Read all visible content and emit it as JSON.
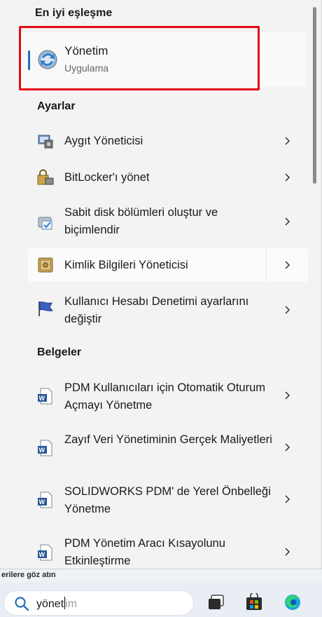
{
  "best_match": {
    "heading": "En iyi eşleşme",
    "name": "Yönetim",
    "type": "Uygulama"
  },
  "settings": {
    "heading": "Ayarlar",
    "items": [
      {
        "label": "Aygıt Yöneticisi",
        "icon": "device-manager-icon"
      },
      {
        "label": "BitLocker'ı yönet",
        "icon": "bitlocker-icon"
      },
      {
        "label": "Sabit disk bölümleri oluştur ve biçimlendir",
        "icon": "disk-partition-icon"
      },
      {
        "label": "Kimlik Bilgileri Yöneticisi",
        "icon": "credential-vault-icon"
      },
      {
        "label": "Kullanıcı Hesabı Denetimi ayarlarını değiştir",
        "icon": "uac-flag-icon"
      }
    ]
  },
  "documents": {
    "heading": "Belgeler",
    "items": [
      {
        "label": "PDM Kullanıcıları için Otomatik Oturum Açmayı Yönetme",
        "icon": "word-document-icon"
      },
      {
        "label": "Zayıf Veri Yönetiminin Gerçek Maliyetleri",
        "icon": "word-document-icon"
      },
      {
        "label": "SOLIDWORKS PDM' de Yerel Önbelleği Yönetme",
        "icon": "word-document-icon"
      },
      {
        "label": "PDM Yönetim Aracı Kısayolunu Etkinleştirme",
        "icon": "word-document-icon"
      }
    ]
  },
  "taskbar": {
    "hint_text": "erilere göz atın",
    "search_typed": "yönet",
    "search_suggest": "im"
  },
  "colors": {
    "highlight_border": "#e50914",
    "accent": "#1f6fb5"
  }
}
